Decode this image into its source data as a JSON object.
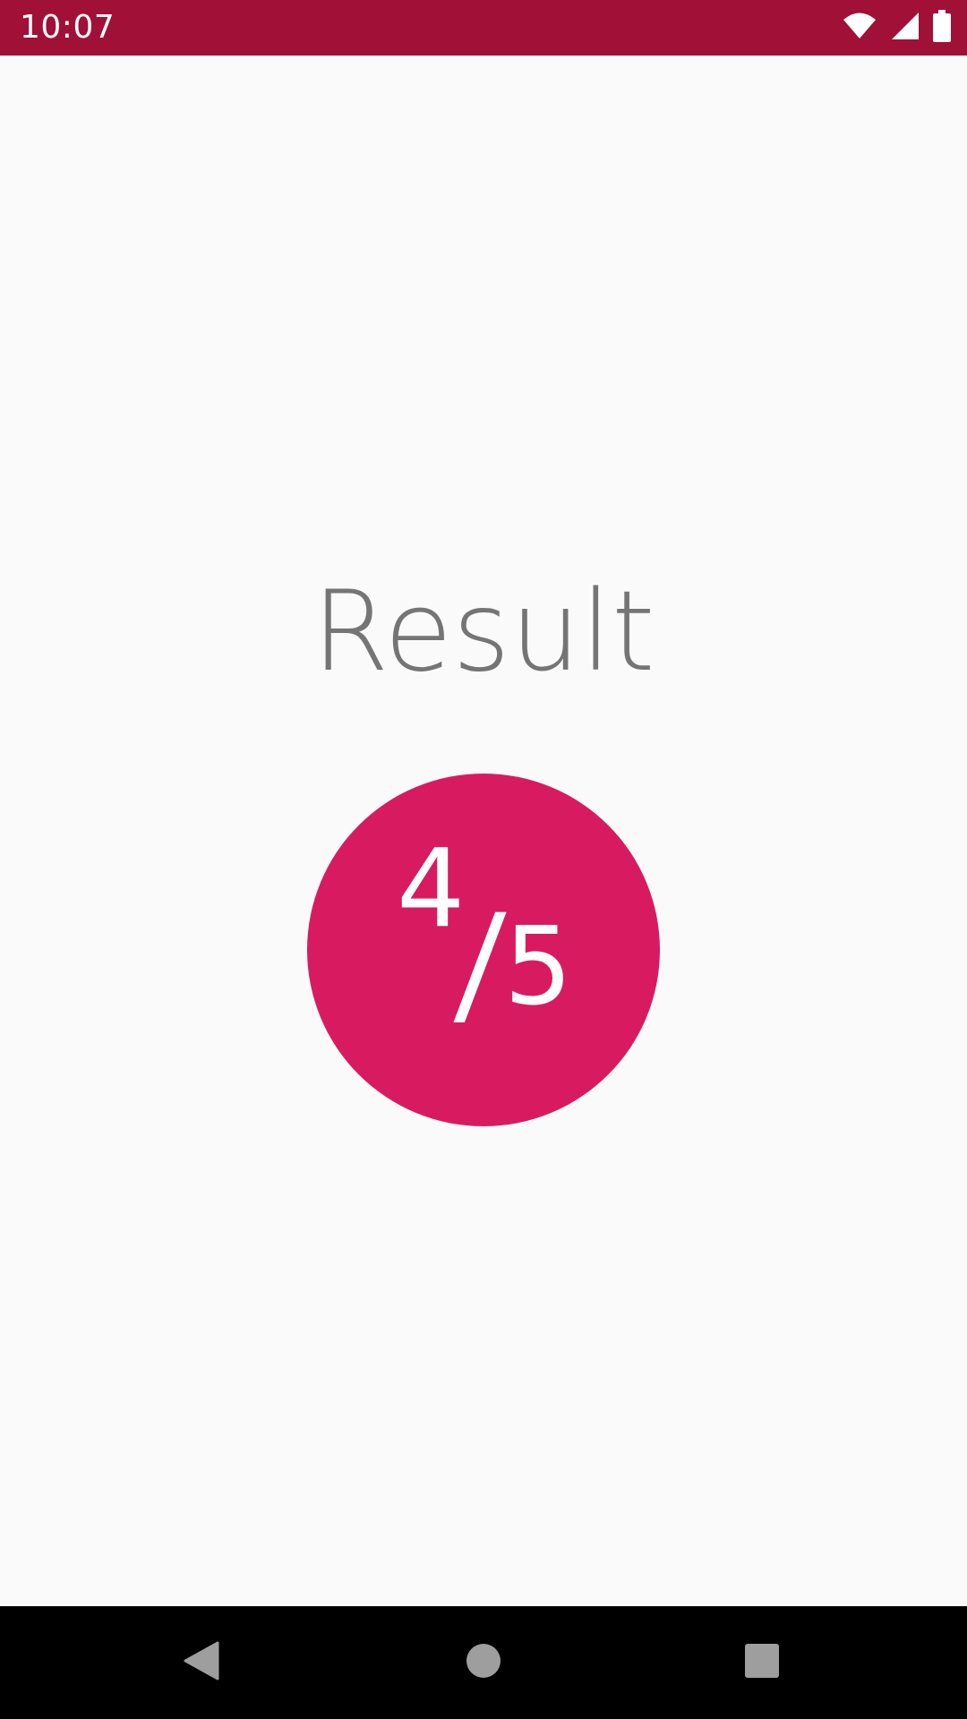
{
  "status_bar": {
    "time": "10:07",
    "icons": [
      "wifi-icon",
      "cellular-signal-icon",
      "battery-icon"
    ],
    "background": "#a11037"
  },
  "result": {
    "title": "Result",
    "score": "4",
    "separator": "/",
    "total": "5",
    "accent_color": "#d81b60",
    "title_color": "#757575"
  },
  "nav_bar": {
    "buttons": [
      "back-icon",
      "home-icon",
      "recents-icon"
    ]
  }
}
